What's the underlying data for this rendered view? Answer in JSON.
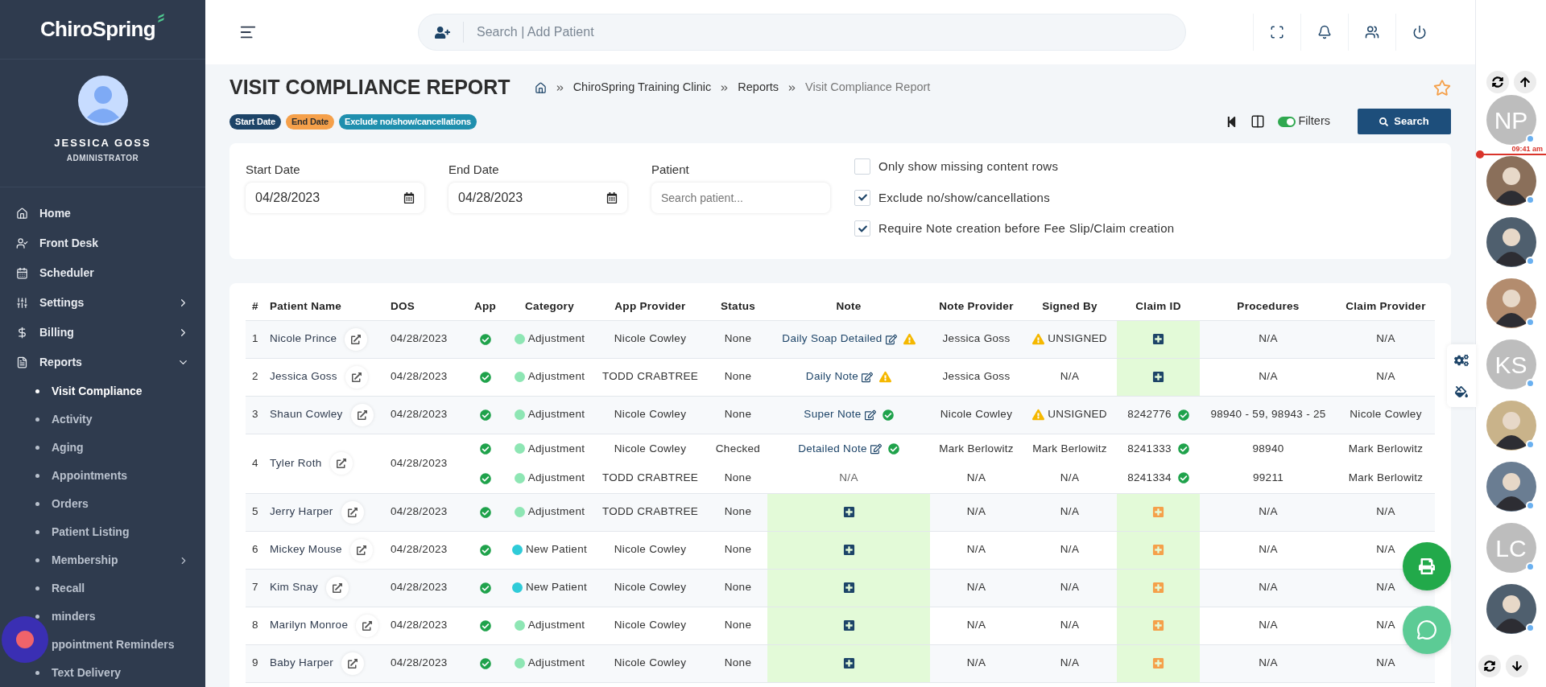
{
  "sidebar": {
    "logo": "ChiroSpring",
    "user": {
      "name": "JESSICA GOSS",
      "role": "ADMINISTRATOR"
    },
    "nav": [
      {
        "label": "Home"
      },
      {
        "label": "Front Desk"
      },
      {
        "label": "Scheduler"
      },
      {
        "label": "Settings",
        "expanded": false
      },
      {
        "label": "Billing",
        "expanded": false
      },
      {
        "label": "Reports",
        "expanded": true,
        "children": [
          {
            "label": "Visit Compliance",
            "selected": true
          },
          {
            "label": "Activity",
            "selected": false
          },
          {
            "label": "Aging",
            "selected": false
          },
          {
            "label": "Appointments",
            "selected": false
          },
          {
            "label": "Orders",
            "selected": false
          },
          {
            "label": "Patient Listing",
            "selected": false
          },
          {
            "label": "Membership",
            "selected": false,
            "expanded": false
          },
          {
            "label": "Recall",
            "selected": false
          },
          {
            "label": "minders",
            "selected": false
          },
          {
            "label": "ppointment Reminders",
            "selected": false
          },
          {
            "label": "Text Delivery",
            "selected": false
          }
        ]
      }
    ]
  },
  "header": {
    "search_placeholder": "Search | Add Patient"
  },
  "page": {
    "title": "VISIT COMPLIANCE REPORT",
    "breadcrumb": [
      "ChiroSpring Training Clinic",
      "Reports",
      "Visit Compliance Report"
    ],
    "favorite": false,
    "badges": [
      {
        "label": "Start Date",
        "color": "#1d4468"
      },
      {
        "label": "End Date",
        "color": "#f5a04a"
      },
      {
        "label": "Exclude no/show/cancellations",
        "color": "#1f8fae"
      }
    ],
    "toolbar": {
      "filters_on": true,
      "filters_label": "Filters",
      "search_label": "Search"
    }
  },
  "filters": {
    "start_date": {
      "label": "Start Date",
      "value": "04/28/2023"
    },
    "end_date": {
      "label": "End Date",
      "value": "04/28/2023"
    },
    "patient": {
      "label": "Patient",
      "placeholder": "Search patient..."
    },
    "options": [
      {
        "label": "Only show missing content rows",
        "checked": false
      },
      {
        "label": "Exclude no/show/cancellations",
        "checked": true
      },
      {
        "label": "Require Note creation before Fee Slip/Claim creation",
        "checked": true
      }
    ]
  },
  "table": {
    "columns": [
      "#",
      "Patient Name",
      "DOS",
      "App",
      "Category",
      "App Provider",
      "Status",
      "Note",
      "Note Provider",
      "Signed By",
      "Claim ID",
      "Procedures",
      "Claim Provider"
    ],
    "rows": [
      {
        "number": "1",
        "patient": "Nicole Prince",
        "dos": "04/28/2023",
        "lines": [
          {
            "category": "Adjustment",
            "color": "#8ee6b4",
            "app_provider": "Nicole Cowley",
            "status": "None",
            "note": {
              "kind": "note",
              "text": "Daily Soap Detailed",
              "complete": false
            },
            "note_provider": "Jessica Goss",
            "signed_by": {
              "text": "UNSIGNED",
              "warning": true
            },
            "claim": {
              "kind": "add",
              "enabled": true
            },
            "procedures": "N/A",
            "claim_provider": "N/A"
          }
        ]
      },
      {
        "number": "2",
        "patient": "Jessica Goss",
        "dos": "04/28/2023",
        "lines": [
          {
            "category": "Adjustment",
            "color": "#8ee6b4",
            "app_provider": "TODD CRABTREE",
            "status": "None",
            "note": {
              "kind": "note",
              "text": "Daily Note",
              "complete": false
            },
            "note_provider": "Jessica Goss",
            "signed_by": {
              "text": "N/A",
              "warning": false
            },
            "claim": {
              "kind": "add",
              "enabled": true
            },
            "procedures": "N/A",
            "claim_provider": "N/A"
          }
        ]
      },
      {
        "number": "3",
        "patient": "Shaun Cowley",
        "dos": "04/28/2023",
        "lines": [
          {
            "category": "Adjustment",
            "color": "#8ee6b4",
            "app_provider": "Nicole Cowley",
            "status": "None",
            "note": {
              "kind": "note",
              "text": "Super Note",
              "complete": true
            },
            "note_provider": "Nicole Cowley",
            "signed_by": {
              "text": "UNSIGNED",
              "warning": true
            },
            "claim": {
              "kind": "id",
              "text": "8242776"
            },
            "procedures": "98940 - 59, 98943 - 25",
            "claim_provider": "Nicole Cowley"
          }
        ]
      },
      {
        "number": "4",
        "patient": "Tyler Roth",
        "dos": "04/28/2023",
        "lines": [
          {
            "category": "Adjustment",
            "color": "#8ee6b4",
            "app_provider": "Nicole Cowley",
            "status": "Checked",
            "note": {
              "kind": "note",
              "text": "Detailed Note",
              "complete": true
            },
            "note_provider": "Mark Berlowitz",
            "signed_by": {
              "text": "Mark Berlowitz",
              "warning": false
            },
            "claim": {
              "kind": "id",
              "text": "8241333"
            },
            "procedures": "98940",
            "claim_provider": "Mark Berlowitz"
          },
          {
            "category": "Adjustment",
            "color": "#8ee6b4",
            "app_provider": "TODD CRABTREE",
            "status": "None",
            "note": {
              "kind": "na",
              "text": "N/A"
            },
            "note_provider": "N/A",
            "signed_by": {
              "text": "N/A",
              "warning": false
            },
            "claim": {
              "kind": "id",
              "text": "8241334"
            },
            "procedures": "99211",
            "claim_provider": "Mark Berlowitz"
          }
        ]
      },
      {
        "number": "5",
        "patient": "Jerry Harper",
        "dos": "04/28/2023",
        "lines": [
          {
            "category": "Adjustment",
            "color": "#8ee6b4",
            "app_provider": "TODD CRABTREE",
            "status": "None",
            "note": {
              "kind": "add"
            },
            "note_provider": "N/A",
            "signed_by": {
              "text": "N/A",
              "warning": false
            },
            "claim": {
              "kind": "add",
              "enabled": false
            },
            "procedures": "N/A",
            "claim_provider": "N/A"
          }
        ]
      },
      {
        "number": "6",
        "patient": "Mickey Mouse",
        "dos": "04/28/2023",
        "lines": [
          {
            "category": "New Patient",
            "color": "#2fcbd8",
            "app_provider": "Nicole Cowley",
            "status": "None",
            "note": {
              "kind": "add"
            },
            "note_provider": "N/A",
            "signed_by": {
              "text": "N/A",
              "warning": false
            },
            "claim": {
              "kind": "add",
              "enabled": false
            },
            "procedures": "N/A",
            "claim_provider": "N/A"
          }
        ]
      },
      {
        "number": "7",
        "patient": "Kim Snay",
        "dos": "04/28/2023",
        "lines": [
          {
            "category": "New Patient",
            "color": "#2fcbd8",
            "app_provider": "Nicole Cowley",
            "status": "None",
            "note": {
              "kind": "add"
            },
            "note_provider": "N/A",
            "signed_by": {
              "text": "N/A",
              "warning": false
            },
            "claim": {
              "kind": "add",
              "enabled": false
            },
            "procedures": "N/A",
            "claim_provider": "N/A"
          }
        ]
      },
      {
        "number": "8",
        "patient": "Marilyn Monroe",
        "dos": "04/28/2023",
        "lines": [
          {
            "category": "Adjustment",
            "color": "#8ee6b4",
            "app_provider": "Nicole Cowley",
            "status": "None",
            "note": {
              "kind": "add"
            },
            "note_provider": "N/A",
            "signed_by": {
              "text": "N/A",
              "warning": false
            },
            "claim": {
              "kind": "add",
              "enabled": false
            },
            "procedures": "N/A",
            "claim_provider": "N/A"
          }
        ]
      },
      {
        "number": "9",
        "patient": "Baby Harper",
        "dos": "04/28/2023",
        "lines": [
          {
            "category": "Adjustment",
            "color": "#8ee6b4",
            "app_provider": "Nicole Cowley",
            "status": "None",
            "note": {
              "kind": "add"
            },
            "note_provider": "N/A",
            "signed_by": {
              "text": "N/A",
              "warning": false
            },
            "claim": {
              "kind": "add",
              "enabled": false
            },
            "procedures": "N/A",
            "claim_provider": "N/A"
          }
        ]
      }
    ]
  },
  "rail": {
    "time": "09:41 am",
    "avatars": [
      {
        "kind": "initials",
        "text": "NP"
      },
      {
        "kind": "photo"
      },
      {
        "kind": "photo"
      },
      {
        "kind": "photo"
      },
      {
        "kind": "initials",
        "text": "KS"
      },
      {
        "kind": "photo"
      },
      {
        "kind": "photo"
      },
      {
        "kind": "initials",
        "text": "LC"
      },
      {
        "kind": "photo"
      }
    ]
  }
}
